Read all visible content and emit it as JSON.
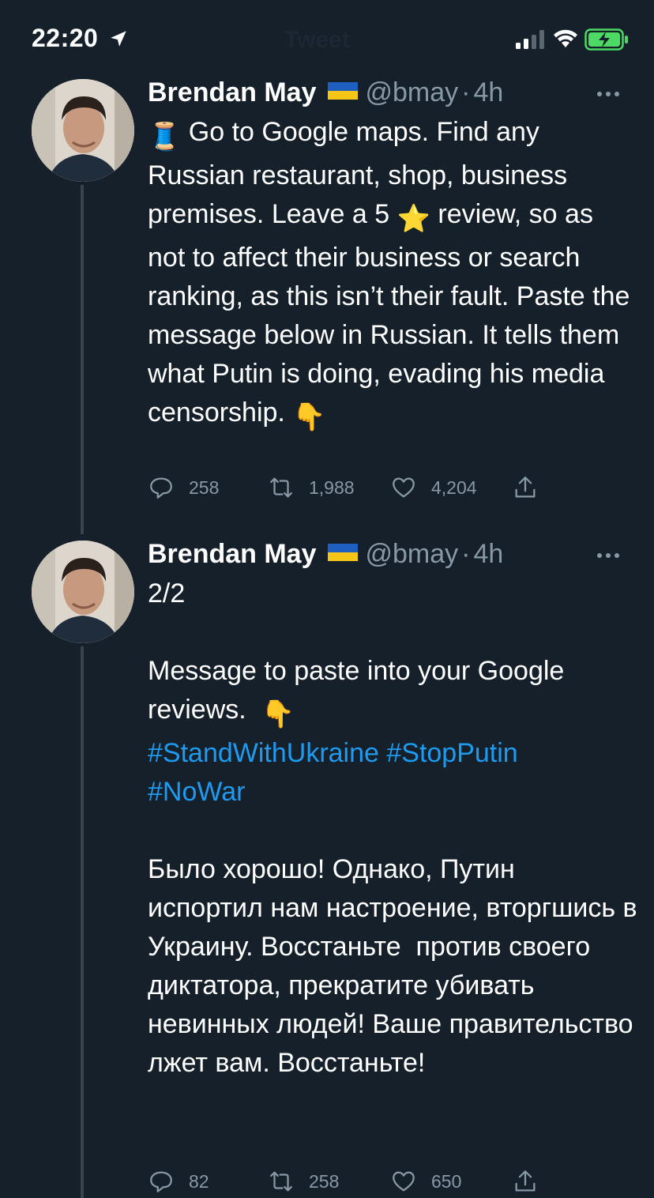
{
  "status_bar": {
    "time": "22:20",
    "title": "Tweet",
    "icons": [
      "location-arrow-icon",
      "signal-icon",
      "wifi-icon",
      "battery-charging-icon"
    ]
  },
  "tweets": [
    {
      "author": "Brendan May",
      "flag": "ukraine-flag-icon",
      "handle": "@bmay",
      "separator": "·",
      "time": "4h",
      "text_lead_emoji": "🧵",
      "text_1": " Go to Google maps. Find any Russian restaurant, shop, business premises. Leave a 5 ",
      "star_emoji": "⭐",
      "text_2": " review, so as not to affect their business or search ranking, as this isn’t their fault. Paste the message below in Russian. It tells them what Putin is doing, evading his media censorship. ",
      "point_emoji": "👇",
      "replies": "258",
      "retweets": "1,988",
      "likes": "4,204"
    },
    {
      "author": "Brendan May",
      "flag": "ukraine-flag-icon",
      "handle": "@bmay",
      "separator": "·",
      "time": "4h",
      "text_1": "2/2\n\nMessage to paste into your Google reviews.  ",
      "point_emoji": "👇",
      "hashtags_1": "#StandWithUkraine #StopPutin",
      "hashtags_2": "#NoWar",
      "text_ru": "Было хорошо! Однако, Путин испортил нам настроение, вторгшись в Украину. Восстаньте  против своего диктатора, прекратите убивать невинных людей! Ваше правительство лжет вам. Восстаньте!",
      "replies": "82",
      "retweets": "258",
      "likes": "650"
    }
  ],
  "colors": {
    "background": "#15202b",
    "text": "#ffffff",
    "secondary": "#8899a6",
    "link": "#1d9bf0",
    "thread_line": "#38444d"
  }
}
